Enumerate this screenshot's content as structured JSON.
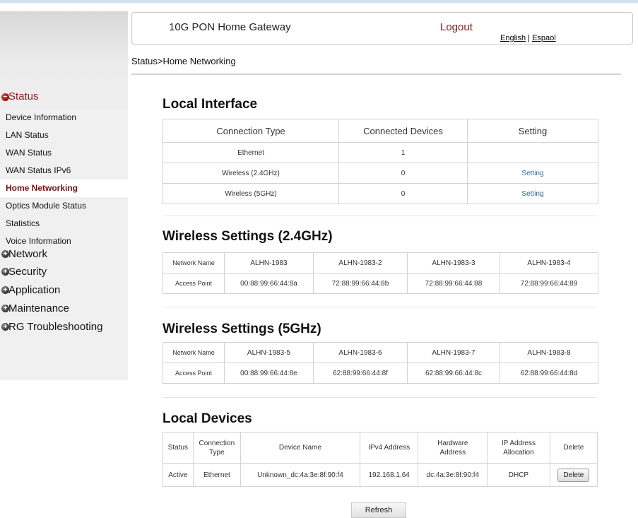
{
  "header": {
    "title": "10G PON Home Gateway",
    "logout": "Logout",
    "lang_en": "English",
    "lang_sep": "|",
    "lang_es": "Espaol"
  },
  "breadcrumb": "Status>Home Networking",
  "sidebar": {
    "status_label": "Status",
    "items": [
      {
        "label": "Device Information"
      },
      {
        "label": "LAN Status"
      },
      {
        "label": "WAN Status"
      },
      {
        "label": "WAN Status IPv6"
      },
      {
        "label": "Home Networking",
        "active": true
      },
      {
        "label": "Optics Module Status"
      },
      {
        "label": "Statistics"
      },
      {
        "label": "Voice Information"
      }
    ],
    "groups": [
      {
        "label": "Network"
      },
      {
        "label": "Security"
      },
      {
        "label": "Application"
      },
      {
        "label": "Maintenance"
      },
      {
        "label": "RG Troubleshooting"
      }
    ]
  },
  "local_interface": {
    "title": "Local Interface",
    "headers": [
      "Connection Type",
      "Connected Devices",
      "Setting"
    ],
    "rows": [
      {
        "type": "Ethernet",
        "count": "1",
        "setting": ""
      },
      {
        "type": "Wireless (2.4GHz)",
        "count": "0",
        "setting": "Setting"
      },
      {
        "type": "Wireless (5GHz)",
        "count": "0",
        "setting": "Setting"
      }
    ]
  },
  "wireless_24": {
    "title": "Wireless Settings (2.4GHz)",
    "name_label": "Network Name",
    "ap_label": "Access Point",
    "names": [
      "ALHN-1983",
      "ALHN-1983-2",
      "ALHN-1983-3",
      "ALHN-1983-4"
    ],
    "aps": [
      "00:88:99:66:44:8a",
      "72:88:99:66:44:8b",
      "72:88:99:66:44:88",
      "72:88:99:66:44:89"
    ]
  },
  "wireless_5": {
    "title": "Wireless Settings (5GHz)",
    "name_label": "Network Name",
    "ap_label": "Access Point",
    "names": [
      "ALHN-1983-5",
      "ALHN-1983-6",
      "ALHN-1983-7",
      "ALHN-1983-8"
    ],
    "aps": [
      "00:88:99:66:44:8e",
      "62:88:99:66:44:8f",
      "62:88:99:66:44:8c",
      "62:88:99:66:44:8d"
    ]
  },
  "local_devices": {
    "title": "Local Devices",
    "headers": {
      "status": "Status",
      "conn_type_1": "Connection",
      "conn_type_2": "Type",
      "device_name": "Device Name",
      "ipv4": "IPv4 Address",
      "hw_1": "Hardware",
      "hw_2": "Address",
      "alloc_1": "IP Address",
      "alloc_2": "Allocation",
      "delete": "Delete"
    },
    "rows": [
      {
        "status": "Active",
        "type": "Ethernet",
        "name": "Unknown_dc:4a:3e:8f:90:f4",
        "ipv4": "192.168.1.64",
        "hw": "dc:4a:3e:8f:90:f4",
        "alloc": "DHCP",
        "delete": "Delete"
      }
    ]
  },
  "refresh_label": "Refresh"
}
